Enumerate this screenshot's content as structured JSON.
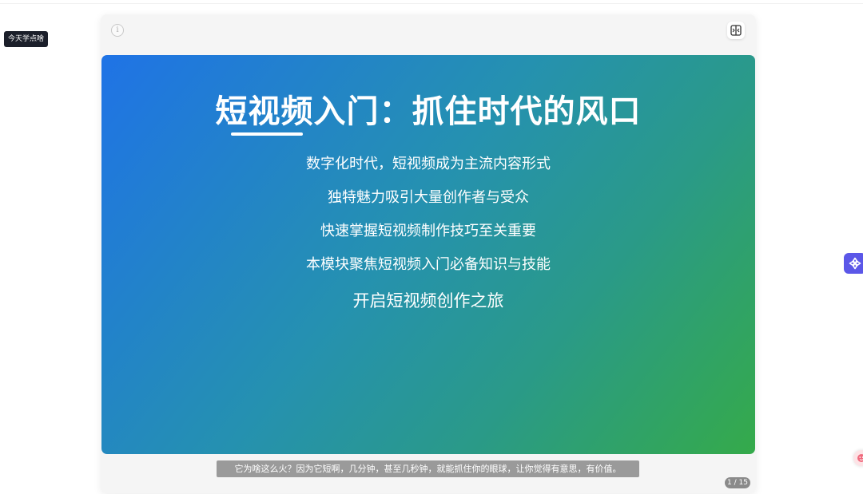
{
  "sidebar": {
    "today_button": "今天学点啥"
  },
  "player": {
    "info_icon_glyph": "i",
    "icons": {
      "info": "info-icon",
      "split": "split-view-icon"
    },
    "subtitle": "它为啥这么火？因为它短啊，几分钟，甚至几秒钟，就能抓住你的眼球，让你觉得有意思，有价值。",
    "page_indicator": "1 / 15"
  },
  "slide": {
    "title": "短视频入门：抓住时代的风口",
    "bullets": [
      "数字化时代，短视频成为主流内容形式",
      "独特魅力吸引大量创作者与受众",
      "快速掌握短视频制作技巧至关重要",
      "本模块聚焦短视频入门必备知识与技能"
    ],
    "closing": "开启短视频创作之旅",
    "colors": {
      "gradient_start": "#1f73e6",
      "gradient_end": "#35aa4a"
    }
  },
  "floating": {
    "icons": {
      "assistant": "assistant-flower-icon",
      "edge": "avatar-icon"
    },
    "colors": {
      "assistant": "#5b57e8"
    }
  }
}
